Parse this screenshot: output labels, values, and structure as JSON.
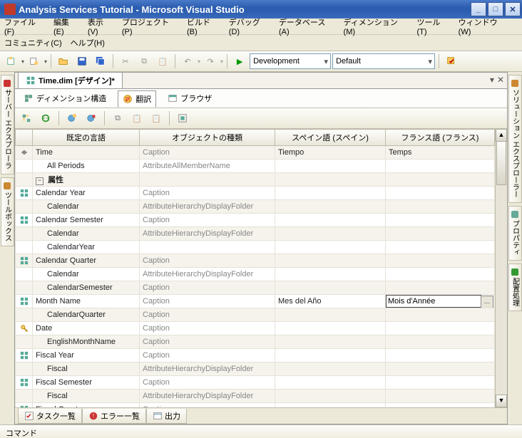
{
  "title": "Analysis Services Tutorial - Microsoft Visual Studio",
  "menu": [
    "ファイル(F)",
    "編集(E)",
    "表示(V)",
    "プロジェクト(P)",
    "ビルド(B)",
    "デバッグ(D)",
    "データベース(A)",
    "ディメンション(M)",
    "ツール(T)",
    "ウィンドウ(W)",
    "コミュニティ(C)",
    "ヘルプ(H)"
  ],
  "config_dropdown": "Development",
  "platform_dropdown": "Default",
  "doc_tab": "Time.dim [デザイン]*",
  "sub_tabs": {
    "structure": "ディメンション構造",
    "translate": "翻訳",
    "browser": "ブラウザ"
  },
  "left_tabs": {
    "server": "サーバー エクスプローラ",
    "toolbox": "ツールボックス"
  },
  "right_tabs": {
    "solution": "ソリューション エクスプローラー",
    "properties": "プロパティ",
    "deploy": "配置処理"
  },
  "grid": {
    "headers": [
      "既定の言語",
      "オブジェクトの種類",
      "スペイン語 (スペイン)",
      "フランス語 (フランス)"
    ],
    "rows": [
      {
        "alt": true,
        "icon": "dim",
        "c1": "Time",
        "c2": "Caption",
        "c3": "Tiempo",
        "c4": "Temps"
      },
      {
        "alt": false,
        "icon": "",
        "c1": "All Periods",
        "c2": "AttributeAllMemberName",
        "c3": "",
        "c4": ""
      },
      {
        "alt": true,
        "icon": "tree",
        "c1": "属性",
        "c2": "",
        "c3": "",
        "c4": ""
      },
      {
        "alt": false,
        "icon": "attr",
        "c1": "Calendar Year",
        "c2": "Caption",
        "c3": "",
        "c4": ""
      },
      {
        "alt": true,
        "icon": "",
        "c1": "Calendar",
        "c2": "AttributeHierarchyDisplayFolder",
        "c3": "",
        "c4": ""
      },
      {
        "alt": false,
        "icon": "attr",
        "c1": "Calendar Semester",
        "c2": "Caption",
        "c3": "",
        "c4": ""
      },
      {
        "alt": true,
        "icon": "",
        "c1": "Calendar",
        "c2": "AttributeHierarchyDisplayFolder",
        "c3": "",
        "c4": ""
      },
      {
        "alt": false,
        "icon": "",
        "c1": "CalendarYear",
        "c2": "",
        "c3": "",
        "c4": ""
      },
      {
        "alt": true,
        "icon": "attr",
        "c1": "Calendar Quarter",
        "c2": "Caption",
        "c3": "",
        "c4": ""
      },
      {
        "alt": false,
        "icon": "",
        "c1": "Calendar",
        "c2": "AttributeHierarchyDisplayFolder",
        "c3": "",
        "c4": ""
      },
      {
        "alt": true,
        "icon": "",
        "c1": "CalendarSemester",
        "c2": "Caption",
        "c3": "",
        "c4": ""
      },
      {
        "alt": false,
        "icon": "attr",
        "c1": "Month Name",
        "c2": "Caption",
        "c3": "Mes del Año",
        "c4": "Mois d'Année",
        "edit": true
      },
      {
        "alt": true,
        "icon": "",
        "c1": "CalendarQuarter",
        "c2": "Caption",
        "c3": "",
        "c4": ""
      },
      {
        "alt": false,
        "icon": "key",
        "c1": "Date",
        "c2": "Caption",
        "c3": "",
        "c4": ""
      },
      {
        "alt": true,
        "icon": "",
        "c1": "EnglishMonthName",
        "c2": "Caption",
        "c3": "",
        "c4": ""
      },
      {
        "alt": false,
        "icon": "attr",
        "c1": "Fiscal Year",
        "c2": "Caption",
        "c3": "",
        "c4": ""
      },
      {
        "alt": true,
        "icon": "",
        "c1": "Fiscal",
        "c2": "AttributeHierarchyDisplayFolder",
        "c3": "",
        "c4": ""
      },
      {
        "alt": false,
        "icon": "attr",
        "c1": "Fiscal Semester",
        "c2": "Caption",
        "c3": "",
        "c4": ""
      },
      {
        "alt": true,
        "icon": "",
        "c1": "Fiscal",
        "c2": "AttributeHierarchyDisplayFolder",
        "c3": "",
        "c4": ""
      },
      {
        "alt": false,
        "icon": "attr",
        "c1": "Fiscal Quarter",
        "c2": "Caption",
        "c3": "",
        "c4": ""
      }
    ]
  },
  "bottom_tabs": {
    "tasks": "タスク一覧",
    "errors": "エラー一覧",
    "output": "出力"
  },
  "status": "コマンド"
}
